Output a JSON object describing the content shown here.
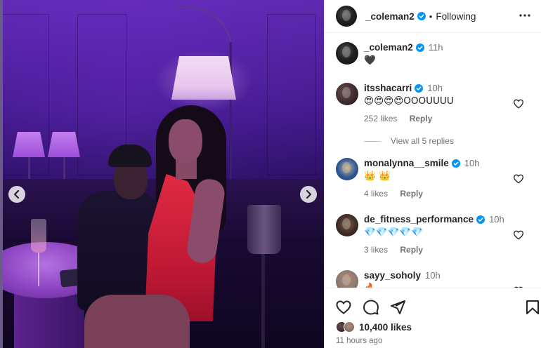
{
  "post": {
    "author": "_coleman2",
    "follow_label": "Following",
    "separator": "•",
    "more_icon": "more-horizontal-icon",
    "caption": {
      "username": "_coleman2",
      "time": "11h",
      "text": "🖤"
    },
    "likes_text": "10,400 likes",
    "time_ago": "11 hours ago"
  },
  "comments": [
    {
      "username": "itsshacarri",
      "verified": true,
      "time": "10h",
      "text": "😍😍😍😍OOOUUUU",
      "likes": "252 likes",
      "reply": "Reply"
    },
    {
      "username": "monalynna__smile",
      "verified": true,
      "time": "10h",
      "text": "👑 👑",
      "likes": "4 likes",
      "reply": "Reply"
    },
    {
      "username": "de_fitness_performance",
      "verified": true,
      "time": "10h",
      "text": "💎💎💎💎💎",
      "likes": "3 likes",
      "reply": "Reply"
    },
    {
      "username": "sayy_soholy",
      "verified": false,
      "time": "10h",
      "text": "🔥"
    }
  ],
  "view_replies": "View all 5 replies",
  "icons": [
    "heart-icon",
    "comment-icon",
    "share-icon",
    "bookmark-icon",
    "chevron-left-icon",
    "chevron-right-icon",
    "verified-badge-icon"
  ],
  "colors": {
    "verified": "#0095f6",
    "text": "#262626",
    "muted": "#737373"
  }
}
